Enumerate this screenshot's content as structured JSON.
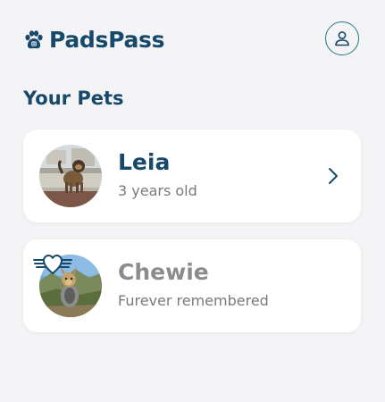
{
  "app": {
    "brand_name": "PadsPass"
  },
  "colors": {
    "brand": "#17496a",
    "accent": "#1f7c80",
    "muted": "#8c8c8c",
    "background": "#f4f4f7"
  },
  "header": {
    "account_icon": "user-icon",
    "logo_icon": "paw-icon"
  },
  "section": {
    "title": "Your Pets"
  },
  "pets": [
    {
      "name": "Leia",
      "subtitle": "3 years old",
      "icon": "chevron-right-icon"
    },
    {
      "name": "Chewie",
      "subtitle": "Furever remembered",
      "icon": "memorial-halo-icon"
    }
  ]
}
